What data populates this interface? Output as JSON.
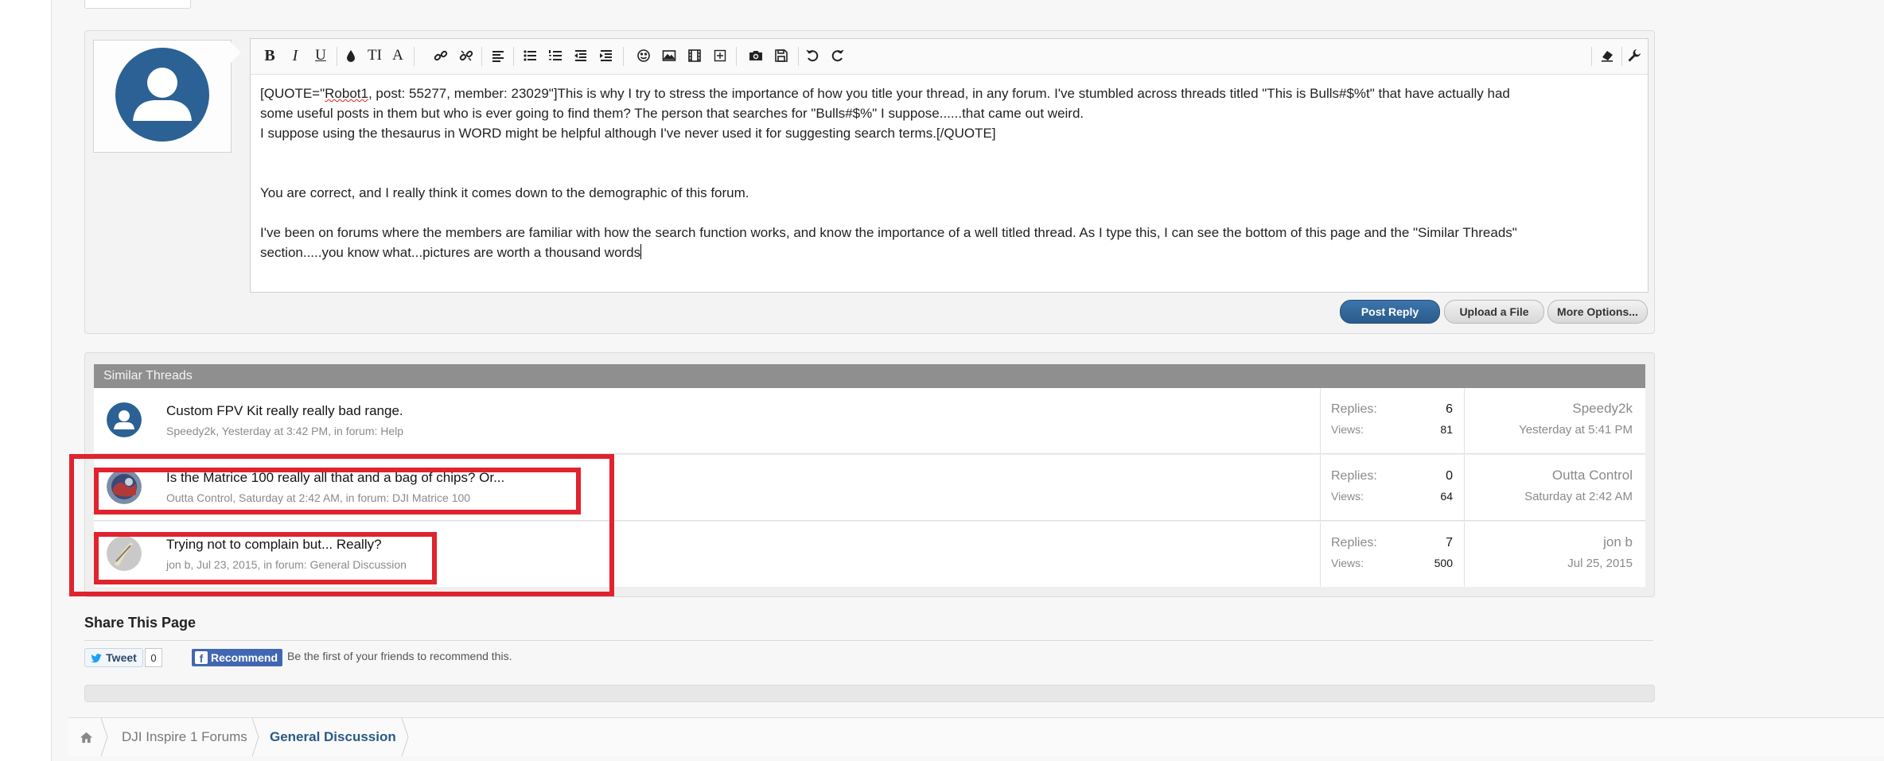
{
  "editor": {
    "toolbar": {
      "bold": "B",
      "italic": "I",
      "underline": "U",
      "font_size": "TI",
      "font_family": "A"
    },
    "quote_open_prefix": "[QUOTE=\"",
    "quote_user": "Robot1",
    "quote_line1_rest": ", post: 55277, member: 23029\"]This is why I try to stress the importance of how you title your thread, in any forum. I've stumbled across threads titled \"This is Bulls#$%t\" that have actually had",
    "quote_line2": "some useful posts in them but who is ever going to find them? The person that searches for \"Bulls#$%\" I suppose......that came out weird.",
    "quote_line3": "I suppose using the thesaurus in WORD might be helpful although I've never used it for suggesting search terms.[/QUOTE]",
    "reply_line1": "You are correct, and I really think it comes down to the demographic of this forum.",
    "reply_line2": "I've been on forums where the members are familiar with how the search function works, and know the importance of a well titled thread. As I type this, I can see the bottom of this page and the \"Similar Threads\"",
    "reply_line3": "section.....you know what...pictures are worth a thousand words"
  },
  "buttons": {
    "post_reply": "Post Reply",
    "upload_file": "Upload a File",
    "more_options": "More Options..."
  },
  "similar_threads": {
    "header": "Similar Threads",
    "replies_label": "Replies:",
    "views_label": "Views:",
    "threads": [
      {
        "title": "Custom FPV Kit really really bad range.",
        "meta": "Speedy2k, Yesterday at 3:42 PM, in forum: Help",
        "replies": "6",
        "views": "81",
        "last_user": "Speedy2k",
        "last_date": "Yesterday at 5:41 PM"
      },
      {
        "title": "Is the Matrice 100 really all that and a bag of chips? Or...",
        "meta": "Outta Control, Saturday at 2:42 AM, in forum: DJI Matrice 100",
        "replies": "0",
        "views": "64",
        "last_user": "Outta Control",
        "last_date": "Saturday at 2:42 AM"
      },
      {
        "title": "Trying not to complain but... Really?",
        "meta": "jon b, Jul 23, 2015, in forum: General Discussion",
        "replies": "7",
        "views": "500",
        "last_user": "jon b",
        "last_date": "Jul 25, 2015"
      }
    ]
  },
  "share": {
    "title": "Share This Page",
    "tweet_label": "Tweet",
    "tweet_count": "0",
    "fb_label": "Recommend",
    "fb_text": "Be the first of your friends to recommend this."
  },
  "breadcrumb": {
    "items": [
      "DJI Inspire 1 Forums",
      "General Discussion"
    ]
  },
  "colors": {
    "accent": "#2b5a86",
    "highlight": "#e0232e",
    "facebook": "#4267b2"
  }
}
